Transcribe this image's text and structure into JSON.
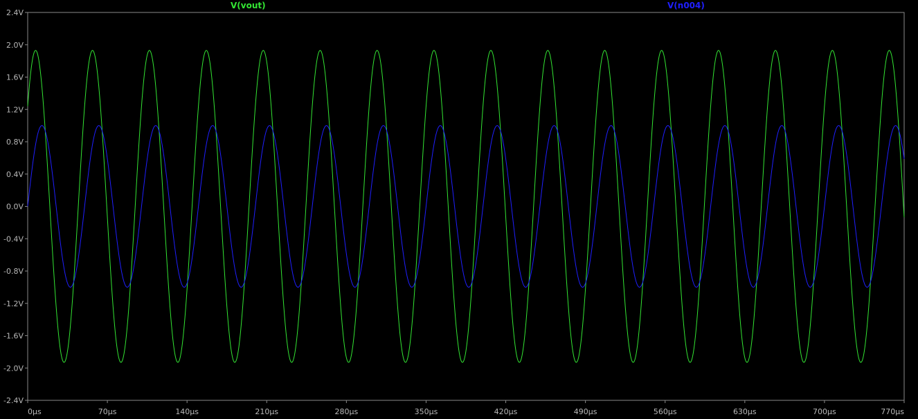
{
  "colors": {
    "background": "#000000",
    "axis": "#8a8a8a",
    "tick_label": "#b8b8b8",
    "vout": "#33e533",
    "n004": "#1f1fff"
  },
  "chart_data": {
    "type": "line",
    "title": "",
    "xlabel": "",
    "ylabel": "",
    "x_unit": "µs",
    "y_unit": "V",
    "xlim": [
      0,
      770
    ],
    "ylim": [
      -2.4,
      2.4
    ],
    "x_ticks": [
      "0µs",
      "70µs",
      "140µs",
      "210µs",
      "280µs",
      "350µs",
      "420µs",
      "490µs",
      "560µs",
      "630µs",
      "700µs",
      "770µs"
    ],
    "y_ticks": [
      "2.4V",
      "2.0V",
      "1.6V",
      "1.2V",
      "0.8V",
      "0.4V",
      "0.0V",
      "-0.4V",
      "-0.8V",
      "-1.2V",
      "-1.6V",
      "-2.0V",
      "-2.4V"
    ],
    "grid": false,
    "legend_placement": "top",
    "series": [
      {
        "name": "V(vout)",
        "color": "#33e533",
        "amplitude_V": 1.93,
        "offset_V": 0,
        "frequency_kHz": 20,
        "phase_deg": 40
      },
      {
        "name": "V(n004)",
        "color": "#1f1fff",
        "amplitude_V": 1.0,
        "offset_V": 0,
        "frequency_kHz": 20,
        "phase_deg": 0
      }
    ]
  }
}
